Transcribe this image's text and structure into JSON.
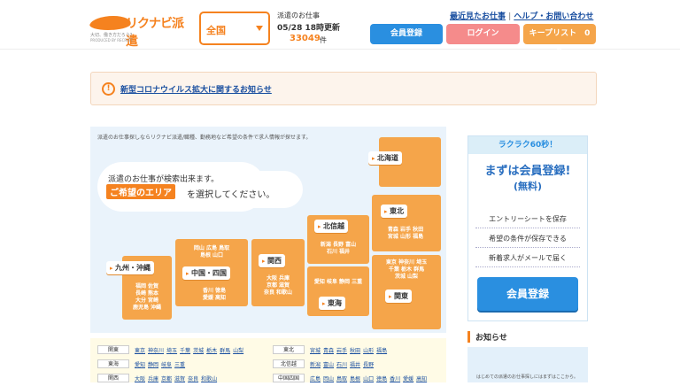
{
  "header": {
    "logo_text": "リクナビ派遣",
    "logo_tagline": "大切、働き方だろう？",
    "logo_producer": "PRODUCED BY RECRUIT",
    "region_value": "全国",
    "job_label": "派遣のお仕事",
    "updated": "05/28 18時更新",
    "job_count": "33049",
    "job_count_unit": "件",
    "link_recent": "最近見たお仕事",
    "link_sep": "|",
    "link_help": "ヘルプ・お問い合わせ",
    "btn_member": "会員登録",
    "btn_login": "ログイン",
    "btn_keep": "キープリスト　0　件"
  },
  "notice": {
    "icon": "exclamation-icon",
    "text": "新型コロナウイルス拡大に関するお知らせ"
  },
  "map": {
    "intro": "派遣のお仕事探しならリクナビ派遣/職種、勤務地など希望の条件で求人情報が探せます。",
    "msg1": "派遣のお仕事が検索出来ます。",
    "msg_highlight": "ご希望のエリア",
    "msg2": "を選択してください。",
    "regions": {
      "hokkaido": {
        "label": "北海道"
      },
      "tohoku": {
        "label": "東北",
        "prefs": "青森 岩手 秋田\n宮城 山形 福島"
      },
      "hokushinetsu": {
        "label": "北信越",
        "prefs": "新潟 長野 富山\n石川 福井"
      },
      "kanto": {
        "label": "関東",
        "prefs": "東京 神奈川 埼玉\n千葉 栃木 群馬\n茨城 山梨"
      },
      "tokai": {
        "label": "東海",
        "prefs": "愛知 岐阜 静岡 三重"
      },
      "kansai": {
        "label": "関西",
        "prefs": "大阪 兵庫\n京都 滋賀\n奈良 和歌山"
      },
      "chugoku": {
        "label": "中国・四国",
        "prefs_top": "岡山 広島 鳥取\n島根 山口",
        "prefs_bottom": "香川 徳島\n愛媛 高知"
      },
      "kyushu": {
        "label": "九州・沖縄",
        "prefs": "福岡 佐賀\n長崎 熊本\n大分 宮崎\n鹿児島 沖縄"
      }
    }
  },
  "list": {
    "rows": [
      {
        "left_tag": "関東",
        "left_links": [
          "東京",
          "神奈川",
          "埼玉",
          "千葉",
          "茨城",
          "栃木",
          "群馬",
          "山梨"
        ],
        "right_tag": "東北",
        "right_links": [
          "宮城",
          "青森",
          "岩手",
          "秋田",
          "山形",
          "福島"
        ]
      },
      {
        "left_tag": "東海",
        "left_links": [
          "愛知",
          "静岡",
          "岐阜",
          "三重"
        ],
        "right_tag": "北信越",
        "right_links": [
          "新潟",
          "富山",
          "石川",
          "福井",
          "長野"
        ]
      },
      {
        "left_tag": "関西",
        "left_links": [
          "大阪",
          "兵庫",
          "京都",
          "滋賀",
          "奈良",
          "和歌山"
        ],
        "right_tag": "中国四国",
        "right_links": [
          "広島",
          "岡山",
          "鳥取",
          "島根",
          "山口",
          "徳島",
          "香川",
          "愛媛",
          "高知"
        ]
      }
    ]
  },
  "sidebar": {
    "banner": "ラクラク60秒！",
    "title": "まずは会員登録!",
    "subtitle": "(無料)",
    "items": [
      "エントリーシートを保存",
      "希望の条件が保存できる",
      "新着求人がメールで届く"
    ],
    "button": "会員登録"
  },
  "news": {
    "heading": "お知らせ",
    "teaser": "はじめての派遣のお仕事探しにはまずはここから。"
  },
  "colors": {
    "accent": "#f5821f",
    "blue": "#2a8fe0",
    "pink": "#f58b8b",
    "map_bg": "#eaf3fb"
  }
}
